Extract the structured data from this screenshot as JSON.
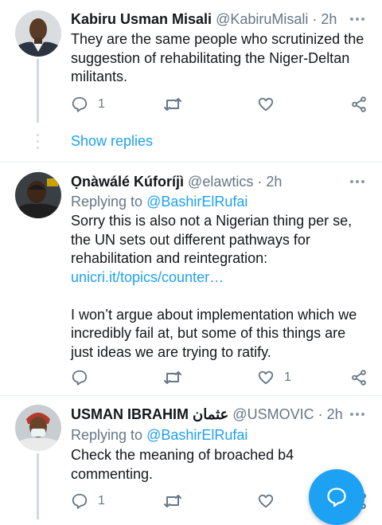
{
  "tweets": [
    {
      "name": "Kabiru Usman Misali",
      "handle": "@KabiruMisali",
      "dot": "·",
      "time": "2h",
      "lines": [
        "They are the same people who scrutinized the",
        "suggestion of rehabilitating the Niger-Deltan",
        "militants."
      ],
      "reply_count": "1",
      "like_count": "",
      "avatar_icon": "user-avatar"
    },
    {
      "name": "Ọnàwálé Kúforíjì",
      "handle": "@elawtics",
      "dot": "·",
      "time": "2h",
      "replying_label": "Replying to",
      "replying_to": "@BashirElRufai",
      "lines": [
        "Sorry this is also not a Nigerian thing per se,",
        "the UN sets out different pathways for",
        "rehabilitation and reintegration:"
      ],
      "link": "unicri.it/topics/counter…",
      "lines2": [
        "I won’t argue about implementation which we",
        "incredibly fail at, but some of this things are",
        "just ideas we are trying to ratify."
      ],
      "reply_count": "",
      "like_count": "1",
      "avatar_icon": "user-avatar"
    },
    {
      "name": "USMAN IBRAHIM عثمان",
      "handle": "@USMOVIC",
      "dot": "·",
      "time": "2h",
      "replying_label": "Replying to",
      "replying_to": "@BashirElRufai",
      "lines": [
        "Check the meaning of broached b4",
        "commenting."
      ],
      "reply_count": "1",
      "like_count": "",
      "avatar_icon": "user-avatar"
    }
  ],
  "show_replies": "Show replies",
  "colors": {
    "accent": "#1da1f2",
    "secondary_text": "#657786",
    "divider": "#e6ecf0",
    "thread_line": "#cfd9de"
  },
  "icons": {
    "reply": "reply-icon",
    "retweet": "retweet-icon",
    "like": "heart-icon",
    "share": "share-icon",
    "more": "more-icon",
    "compose": "compose-reply-icon"
  }
}
